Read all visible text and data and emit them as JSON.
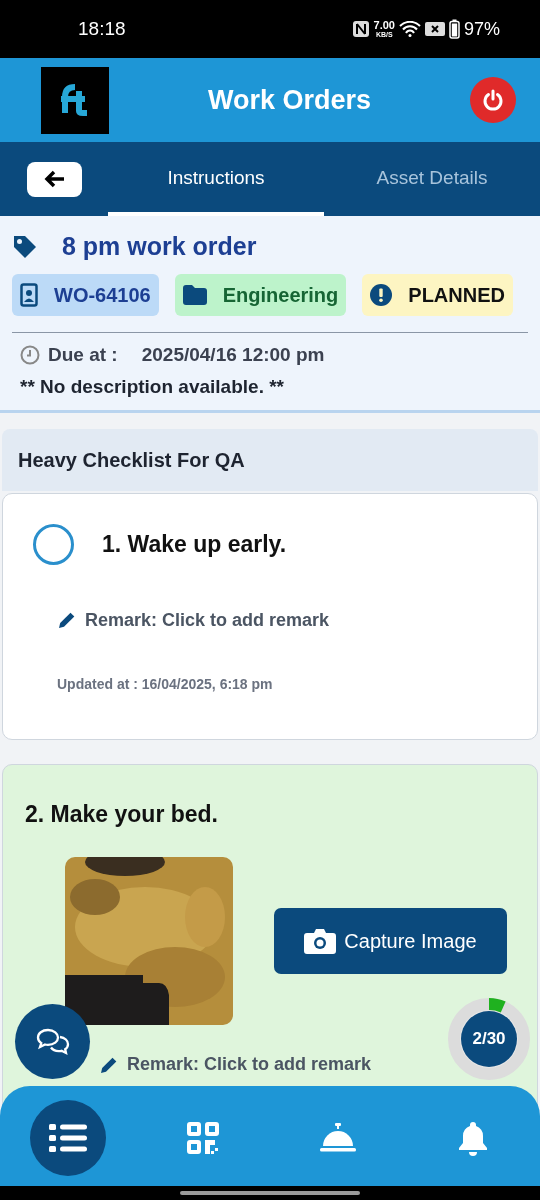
{
  "status_bar": {
    "time": "18:18",
    "net_speed": "7.00",
    "net_unit": "KB/S",
    "battery": "97%"
  },
  "header": {
    "title": "Work Orders"
  },
  "tabs": [
    {
      "label": "Instructions",
      "selected": true
    },
    {
      "label": "Asset Details",
      "selected": false
    }
  ],
  "work_order": {
    "title": "8 pm work order",
    "id": "WO-64106",
    "category": "Engineering",
    "status": "PLANNED",
    "due_label": "Due at :",
    "due_value": "2025/04/16 12:00 pm",
    "description": "** No description available. **"
  },
  "checklist": {
    "title": "Heavy Checklist For QA",
    "items": [
      {
        "kind": "checkbox",
        "title": "1. Wake up early.",
        "completed": false,
        "checked": false,
        "remark": "Remark: Click to add remark",
        "updated": "Updated at : 16/04/2025, 6:18 pm"
      },
      {
        "title": "2. Make your bed.",
        "completed": true,
        "button": "Capture Image",
        "remark": "Remark: Click to add remark"
      }
    ]
  },
  "progress": {
    "text": "2/30"
  },
  "bottom_nav": [
    {
      "kind": "list",
      "selected": true
    },
    {
      "kind": "qr",
      "selected": false
    },
    {
      "kind": "service",
      "selected": false
    },
    {
      "kind": "bell",
      "selected": false
    }
  ]
}
